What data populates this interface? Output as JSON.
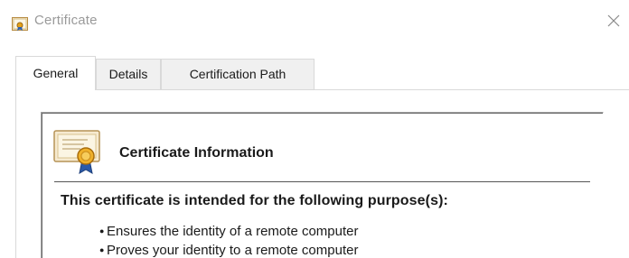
{
  "window": {
    "title": "Certificate",
    "title_icon": "certificate-small-icon",
    "close_icon": "close-icon"
  },
  "tabs": [
    {
      "label": "General",
      "active": true
    },
    {
      "label": "Details",
      "active": false
    },
    {
      "label": "Certification Path",
      "active": false
    }
  ],
  "general": {
    "cert_icon": "certificate-ribbon-icon",
    "heading": "Certificate Information",
    "purpose_heading": "This certificate is intended for the following purpose(s):",
    "purposes": [
      "Ensures the identity of a remote computer",
      "Proves your identity to a remote computer"
    ]
  }
}
